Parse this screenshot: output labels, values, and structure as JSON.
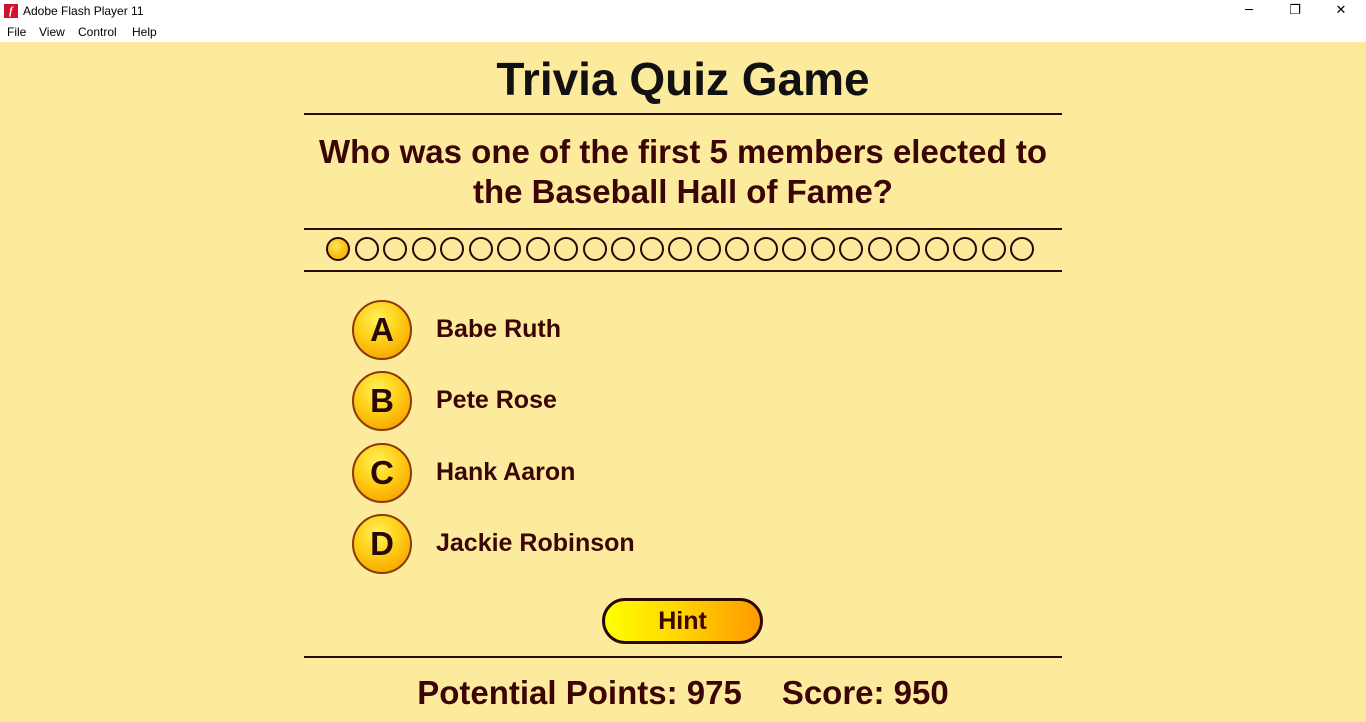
{
  "window": {
    "title": "Adobe Flash Player 11",
    "app_icon": "flash-player-icon",
    "app_icon_glyph": "f",
    "minimize_glyph": "─",
    "maximize_glyph": "❐",
    "close_glyph": "✕"
  },
  "menu": {
    "items": [
      "File",
      "View",
      "Control",
      "Help"
    ]
  },
  "game": {
    "title": "Trivia Quiz Game",
    "question": "Who was one of the first 5 members elected to the Baseball Hall of Fame?",
    "progress": {
      "total": 25,
      "current": 1
    },
    "answers": [
      {
        "letter": "A",
        "text": "Babe Ruth"
      },
      {
        "letter": "B",
        "text": "Pete Rose"
      },
      {
        "letter": "C",
        "text": "Hank Aaron"
      },
      {
        "letter": "D",
        "text": "Jackie Robinson"
      }
    ],
    "hint_label": "Hint",
    "potential_points_label": "Potential Points: 975",
    "score_label": "Score: 950"
  },
  "colors": {
    "background": "#fdeb9d",
    "text": "#3b0505",
    "accent": "#f7b800"
  }
}
